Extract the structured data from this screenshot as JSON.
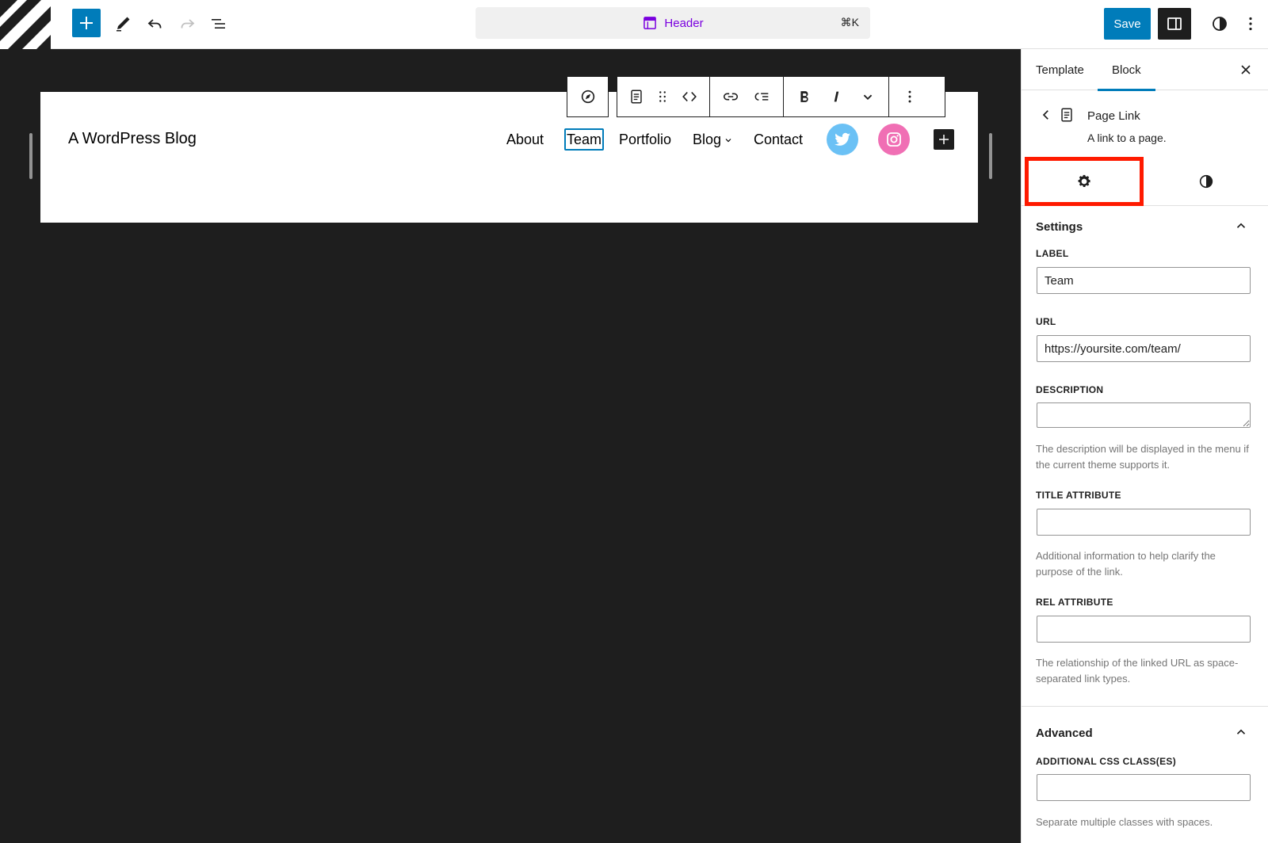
{
  "topbar": {
    "document_title": "Header",
    "shortcut": "⌘K",
    "save_label": "Save"
  },
  "canvas": {
    "site_title": "A WordPress Blog",
    "nav_items": [
      "About",
      "Team",
      "Portfolio",
      "Blog",
      "Contact"
    ],
    "selected_nav_item": "Team",
    "social_colors": {
      "twitter": "#6bc1f5",
      "instagram": "#f06fb4"
    }
  },
  "sidebar": {
    "tabs": [
      "Template",
      "Block"
    ],
    "active_tab": "Block",
    "block": {
      "title": "Page Link",
      "description": "A link to a page."
    },
    "settings": {
      "title": "Settings",
      "label_label": "LABEL",
      "label_value": "Team",
      "url_label": "URL",
      "url_value": "https://yoursite.com/team/",
      "description_label": "DESCRIPTION",
      "description_help": "The description will be displayed in the menu if the current theme supports it.",
      "title_attr_label": "TITLE ATTRIBUTE",
      "title_attr_help": "Additional information to help clarify the purpose of the link.",
      "rel_label": "REL ATTRIBUTE",
      "rel_help": "The relationship of the linked URL as space-separated link types."
    },
    "advanced": {
      "title": "Advanced",
      "css_label": "ADDITIONAL CSS CLASS(ES)",
      "css_help": "Separate multiple classes with spaces."
    }
  },
  "colors": {
    "accent": "#007cba",
    "highlight": "#ff1a00",
    "doc_title": "#7a00df"
  }
}
